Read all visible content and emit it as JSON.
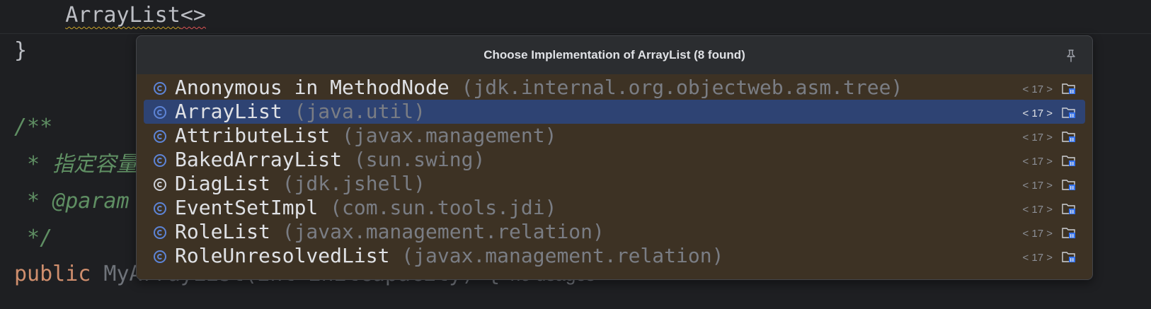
{
  "editor": {
    "line_top_indent": "    ",
    "line_top_type": "ArrayList",
    "line_top_angle": "<>",
    "line_brace": "}",
    "line_javadoc_open": "/**",
    "line_javadoc_desc": " * 指定容量",
    "line_javadoc_param": " * @param",
    "line_javadoc_close": " */",
    "line_public_kw": "public",
    "line_public_rest": " MyArrayList(int initCapacity) {",
    "line_public_usages": "  no usages"
  },
  "popup": {
    "title": "Choose Implementation of ArrayList (8 found)",
    "pin_icon": "pin-icon",
    "rows": [
      {
        "name": "Anonymous in MethodNode",
        "package": " (jdk.internal.org.objectweb.asm.tree)",
        "version": "< 17 >",
        "icon": "class-icon",
        "selected": false
      },
      {
        "name": "ArrayList",
        "package": " (java.util)",
        "version": "< 17 >",
        "icon": "class-icon",
        "selected": true
      },
      {
        "name": "AttributeList",
        "package": " (javax.management)",
        "version": "< 17 >",
        "icon": "class-icon",
        "selected": false
      },
      {
        "name": "BakedArrayList",
        "package": " (sun.swing)",
        "version": "< 17 >",
        "icon": "class-icon",
        "selected": false
      },
      {
        "name": "DiagList",
        "package": " (jdk.jshell)",
        "version": "< 17 >",
        "icon": "class-icon-pinned",
        "selected": false
      },
      {
        "name": "EventSetImpl",
        "package": " (com.sun.tools.jdi)",
        "version": "< 17 >",
        "icon": "class-icon",
        "selected": false
      },
      {
        "name": "RoleList",
        "package": " (javax.management.relation)",
        "version": "< 17 >",
        "icon": "class-icon",
        "selected": false
      },
      {
        "name": "RoleUnresolvedList",
        "package": " (javax.management.relation)",
        "version": "< 17 >",
        "icon": "class-icon",
        "selected": false
      }
    ]
  },
  "colors": {
    "selection": "#2e4373",
    "list_background": "#3d3224",
    "class_icon": "#5d84d6"
  }
}
